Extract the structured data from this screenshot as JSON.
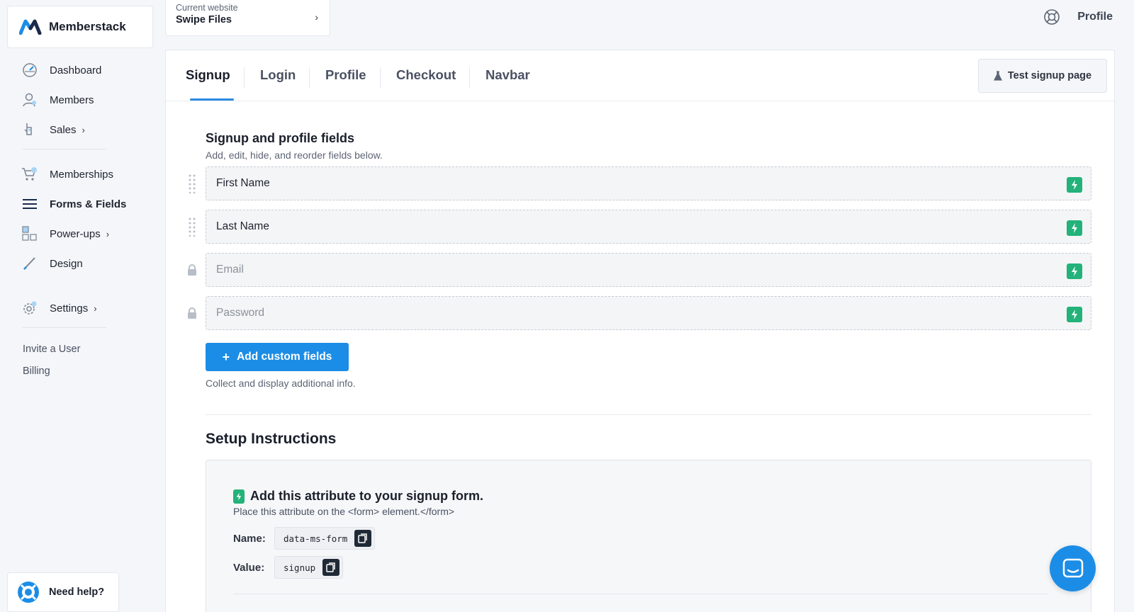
{
  "brand": {
    "name": "Memberstack"
  },
  "sidebar": {
    "nav_main": [
      {
        "label": "Dashboard",
        "icon": "dashboard-icon"
      },
      {
        "label": "Members",
        "icon": "members-icon"
      },
      {
        "label": "Sales",
        "icon": "sales-icon",
        "chevron": "›"
      }
    ],
    "nav_build": [
      {
        "label": "Memberships",
        "icon": "memberships-icon"
      },
      {
        "label": "Forms & Fields",
        "icon": "forms-icon",
        "active": true
      },
      {
        "label": "Power-ups",
        "icon": "power-ups-icon",
        "chevron": "›"
      },
      {
        "label": "Design",
        "icon": "design-icon"
      }
    ],
    "nav_settings": [
      {
        "label": "Settings",
        "icon": "settings-icon",
        "chevron": "›"
      }
    ],
    "links": [
      "Invite a User",
      "Billing"
    ],
    "help_label": "Need help?"
  },
  "topbar": {
    "site_caption": "Current website",
    "site_name": "Swipe Files",
    "site_chevron": "›",
    "profile_label": "Profile"
  },
  "tabs": [
    "Signup",
    "Login",
    "Profile",
    "Checkout",
    "Navbar"
  ],
  "active_tab": "Signup",
  "test_button_label": "Test signup page",
  "fields_section": {
    "title": "Signup and profile fields",
    "subtitle": "Add, edit, hide, and reorder fields below.",
    "fields": [
      {
        "name": "First Name",
        "locked": false
      },
      {
        "name": "Last Name",
        "locked": false
      },
      {
        "name": "Email",
        "locked": true
      },
      {
        "name": "Password",
        "locked": true
      }
    ],
    "add_button_label": "Add custom fields",
    "add_button_icon": "+",
    "add_hint": "Collect and display additional info."
  },
  "setup": {
    "title": "Setup Instructions",
    "attr_title": "Add this attribute to your signup form.",
    "attr_sub": "Place this attribute on the <form> element.</form>",
    "name_key": "Name:",
    "name_value": "data-ms-form",
    "value_key": "Value:",
    "value_value": "signup"
  },
  "colors": {
    "accent": "#1c8de6",
    "tab_underline": "#2b8be0",
    "bolt_green": "#23b27a"
  }
}
